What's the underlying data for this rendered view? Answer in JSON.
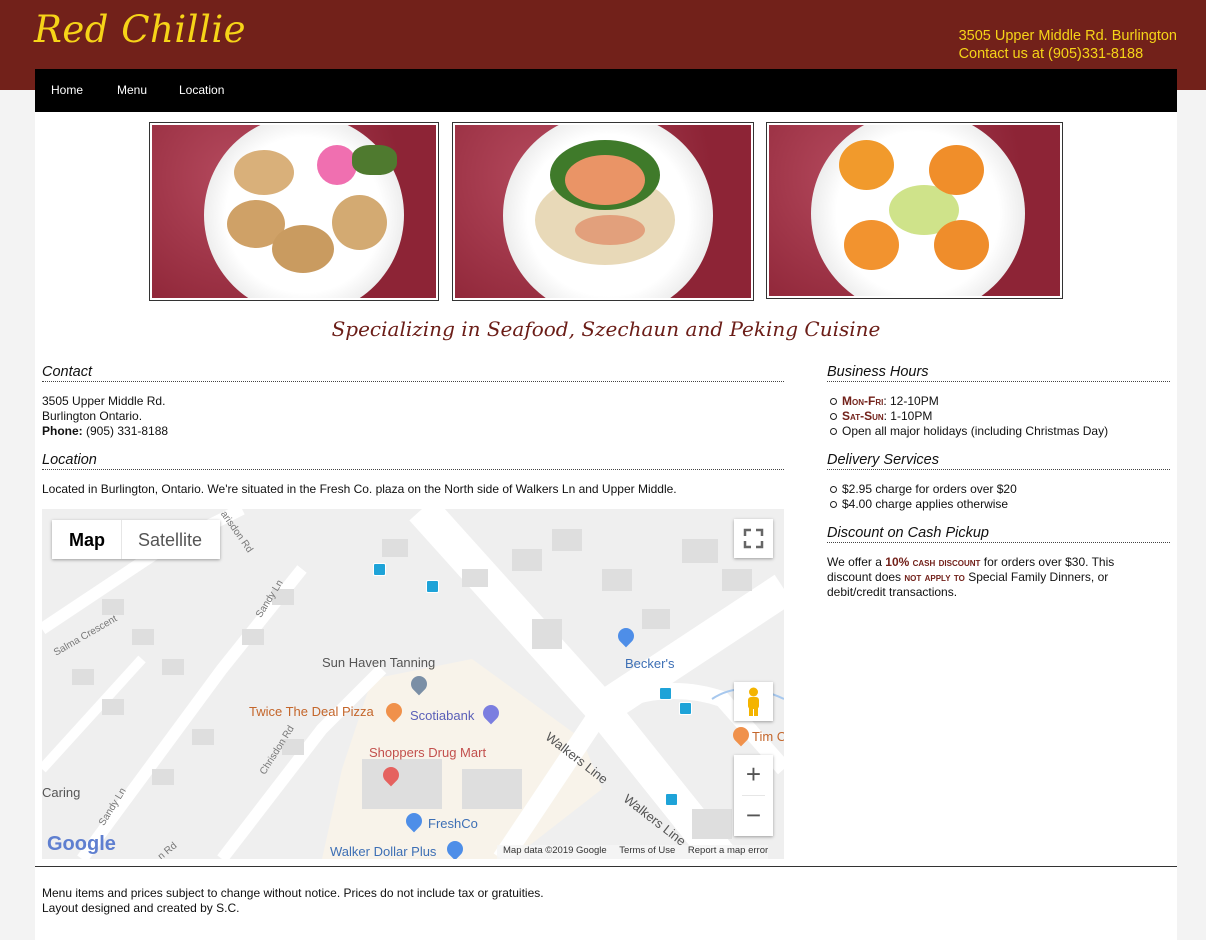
{
  "header": {
    "logo": "Red Chillie",
    "address": "3505 Upper Middle Rd. Burlington",
    "contact": "Contact us at (905)331-8188"
  },
  "nav": {
    "items": [
      "Home",
      "Menu",
      "Location"
    ]
  },
  "tagline": "Specializing in Seafood, Szechaun and Peking Cuisine",
  "contact": {
    "title": "Contact",
    "street": "3505 Upper Middle Rd.",
    "city": "Burlington Ontario.",
    "phone_label": "Phone:",
    "phone": " (905) 331-8188"
  },
  "location": {
    "title": "Location",
    "text": "Located in Burlington, Ontario. We're situated in the Fresh Co. plaza on the North side of Walkers Ln and Upper Middle."
  },
  "map": {
    "map_button": "Map",
    "satellite_button": "Satellite",
    "labels": {
      "sun_haven": "Sun Haven Tanning",
      "beckers": "Becker's",
      "twice": "Twice The Deal Pizza",
      "scotiabank": "Scotiabank",
      "shoppers": "Shoppers Drug Mart",
      "freshco": "FreshCo",
      "walker_dollar": "Walker Dollar Plus",
      "walkers_line_1": "Walkers Line",
      "walkers_line_2": "Walkers Line",
      "tim": "Tim C",
      "salma": "Salma Crescent",
      "sandy_ln_1": "Sandy Ln",
      "sandy_ln_2": "Sandy Ln",
      "chrisdon_1": "Chrisdon Rd",
      "chrisdon_2": "Chrisdon Rd",
      "arisdon": "arisdon Rd",
      "caring": "Caring",
      "rd_bottom": "n Rd"
    },
    "google": "Google",
    "attribution": "Map data ©2019 Google",
    "terms": "Terms of Use",
    "report": "Report a map error",
    "zoom_in": "+",
    "zoom_out": "−"
  },
  "hours": {
    "title": "Business Hours",
    "items": [
      {
        "label": "Mon-Fri",
        "value": ": 12-10PM"
      },
      {
        "label": "Sat-Sun",
        "value": ": 1-10PM"
      },
      {
        "label": "",
        "value": "Open all major holidays (including Christmas Day)"
      }
    ]
  },
  "delivery": {
    "title": "Delivery Services",
    "items": [
      "$2.95 charge for orders over $20",
      "$4.00 charge applies otherwise"
    ]
  },
  "discount": {
    "title": "Discount on Cash Pickup",
    "t1": "We offer a ",
    "highlight1": "10% cash discount",
    "t2": " for orders over $30. This discount does ",
    "highlight2": "not apply to",
    "t3": " Special Family Dinners, or debit/credit transactions."
  },
  "footer": {
    "line1": "Menu items and prices subject to change without notice. Prices do not include tax or gratuities.",
    "line2": "Layout designed and created by S.C."
  },
  "colors": {
    "brand": "#72211a",
    "gold": "#f6d418"
  }
}
